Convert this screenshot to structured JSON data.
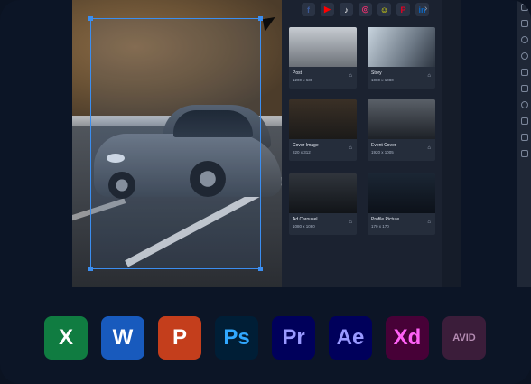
{
  "social_icons": [
    {
      "name": "facebook-icon",
      "glyph": "f",
      "color": "#3b5998"
    },
    {
      "name": "youtube-icon",
      "glyph": "▶",
      "color": "#ff0000"
    },
    {
      "name": "tiktok-icon",
      "glyph": "♪",
      "color": "#ffffff"
    },
    {
      "name": "instagram-icon",
      "glyph": "◎",
      "color": "#e1306c"
    },
    {
      "name": "snapchat-icon",
      "glyph": "☺",
      "color": "#fffc00"
    },
    {
      "name": "pinterest-icon",
      "glyph": "P",
      "color": "#e60023"
    },
    {
      "name": "linkedin-icon",
      "glyph": "in",
      "color": "#0a66c2"
    }
  ],
  "more_label": "›",
  "cards": [
    {
      "title": "Post",
      "size": "1200 x 630"
    },
    {
      "title": "Story",
      "size": "1080 x 1080"
    },
    {
      "title": "Cover Image",
      "size": "820 x 312"
    },
    {
      "title": "Event Cover",
      "size": "1920 x 1005"
    },
    {
      "title": "Ad Carousel",
      "size": "1080 x 1080"
    },
    {
      "title": "Profile Picture",
      "size": "170 x 170"
    }
  ],
  "apps": [
    {
      "name": "excel-icon",
      "label": "X",
      "bg": "#107c41",
      "fg": "#ffffff"
    },
    {
      "name": "word-icon",
      "label": "W",
      "bg": "#185abd",
      "fg": "#ffffff"
    },
    {
      "name": "powerpoint-icon",
      "label": "P",
      "bg": "#c43e1c",
      "fg": "#ffffff"
    },
    {
      "name": "photoshop-icon",
      "label": "Ps",
      "bg": "#001e36",
      "fg": "#31a8ff"
    },
    {
      "name": "premiere-icon",
      "label": "Pr",
      "bg": "#00005b",
      "fg": "#9999ff"
    },
    {
      "name": "after-effects-icon",
      "label": "Ae",
      "bg": "#00005b",
      "fg": "#9999ff"
    },
    {
      "name": "xd-icon",
      "label": "Xd",
      "bg": "#470137",
      "fg": "#ff61f6"
    },
    {
      "name": "avid-icon",
      "label": "AVID",
      "bg": "#3b1d3a",
      "fg": "#b58cb3"
    }
  ]
}
